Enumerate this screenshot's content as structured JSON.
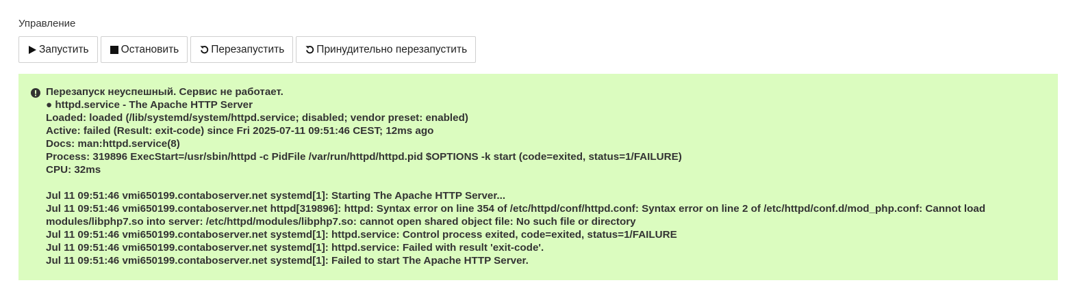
{
  "section": {
    "label": "Управление"
  },
  "buttons": [
    {
      "label": "Запустить",
      "icon": "play-icon"
    },
    {
      "label": "Остановить",
      "icon": "stop-icon"
    },
    {
      "label": "Перезапустить",
      "icon": "restart-icon"
    },
    {
      "label": "Принудительно перезапустить",
      "icon": "restart-icon"
    }
  ],
  "alert": {
    "icon": "exclamation-circle-icon",
    "background": "#dbfcbf",
    "lines": [
      "Перезапуск неуспешный. Сервис не работает.",
      "● httpd.service - The Apache HTTP Server",
      "Loaded: loaded (/lib/systemd/system/httpd.service; disabled; vendor preset: enabled)",
      "Active: failed (Result: exit-code) since Fri 2025-07-11 09:51:46 CEST; 12ms ago",
      "Docs: man:httpd.service(8)",
      "Process: 319896 ExecStart=/usr/sbin/httpd -c PidFile /var/run/httpd/httpd.pid $OPTIONS -k start (code=exited, status=1/FAILURE)",
      "CPU: 32ms"
    ],
    "log_lines": [
      "Jul 11 09:51:46 vmi650199.contaboserver.net systemd[1]: Starting The Apache HTTP Server...",
      "Jul 11 09:51:46 vmi650199.contaboserver.net httpd[319896]: httpd: Syntax error on line 354 of /etc/httpd/conf/httpd.conf: Syntax error on line 2 of /etc/httpd/conf.d/mod_php.conf: Cannot load modules/libphp7.so into server: /etc/httpd/modules/libphp7.so: cannot open shared object file: No such file or directory",
      "Jul 11 09:51:46 vmi650199.contaboserver.net systemd[1]: httpd.service: Control process exited, code=exited, status=1/FAILURE",
      "Jul 11 09:51:46 vmi650199.contaboserver.net systemd[1]: httpd.service: Failed with result 'exit-code'.",
      "Jul 11 09:51:46 vmi650199.contaboserver.net systemd[1]: Failed to start The Apache HTTP Server."
    ]
  }
}
